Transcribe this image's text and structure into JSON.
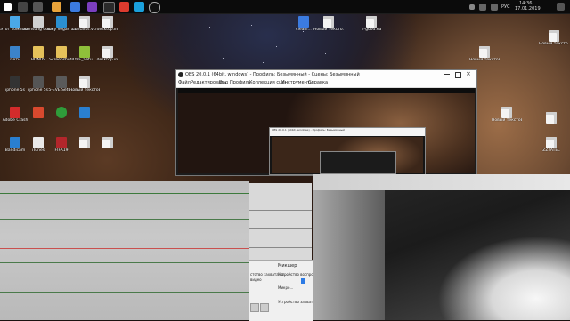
{
  "taskbar": {
    "clock_time": "14:36",
    "clock_date": "17.01.2019",
    "lang": "РУС"
  },
  "desktop": {
    "left_icons": [
      {
        "label": "Этот компьютер"
      },
      {
        "label": "Samsung обьед."
      },
      {
        "label": "Sony Vegas 13 x64 ен"
      },
      {
        "label": "contacts.vcf"
      },
      {
        "label": "desktop.ini"
      },
      {
        "label": "Сеть"
      },
      {
        "label": "BONUS"
      },
      {
        "label": "Screenshots"
      },
      {
        "label": "DVE_Setu..."
      },
      {
        "label": "desktop.ini"
      },
      {
        "label": "iphone 5s"
      },
      {
        "label": "iphone 5s"
      },
      {
        "label": "5-EVE Setu..."
      },
      {
        "label": "Adobe Crash"
      },
      {
        "label": "Новый текстов..."
      },
      {
        "label": "Bandicam"
      },
      {
        "label": "iTunes"
      },
      {
        "label": "FIFA19"
      }
    ],
    "right_icons": [
      {
        "label": "cleanl..."
      },
      {
        "label": "Новый тексто..."
      },
      {
        "label": "fi-good.ea"
      },
      {
        "label": "Новый тексто..."
      },
      {
        "label": "Новый текстов..."
      },
      {
        "label": "Новый текстов..."
      },
      {
        "label": "ZZYATEL"
      }
    ]
  },
  "obs": {
    "title": "OBS 20.0.1 (64bit, windows) - Профиль: Безымянный - Сцены: Безымянный",
    "menu": [
      "Файл",
      "Редактировать",
      "Вид",
      "Профиль",
      "Коллекция сцен",
      "Инструменты",
      "Справка"
    ],
    "nested_title": "OBS 20.0.1 (64bit, windows) - Профиль: Безымянный"
  },
  "mixer": {
    "header": "Микшер",
    "device_label": "Устройство воспроизв...",
    "mic_label": "Микро...",
    "device_label2": "Устройство захвата ви...",
    "left_label": "стство захвата ви...",
    "left_label2": "видео"
  },
  "colors": {
    "taskbar": "#0b0b0b",
    "obs_window": "#1c1c1c",
    "accent": "#2d7be5"
  }
}
